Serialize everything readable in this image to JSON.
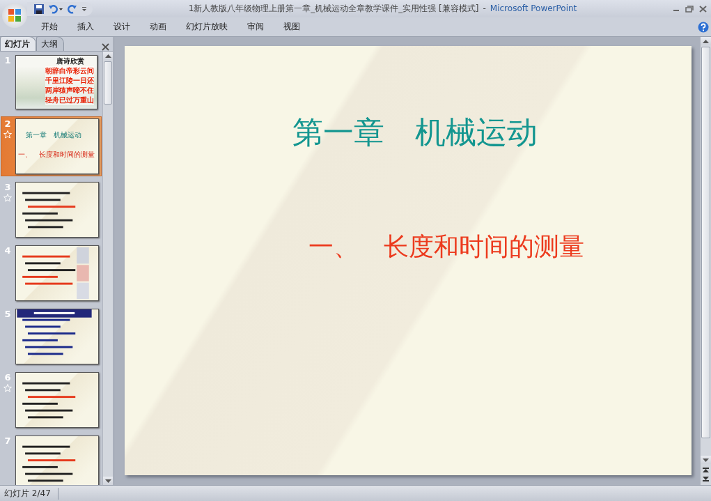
{
  "window": {
    "document_title": "1新人教版八年级物理上册第一章_机械运动全章教学课件_实用性强 [兼容模式]",
    "separator": "-",
    "app_name": "Microsoft PowerPoint"
  },
  "ribbon_tabs": [
    "开始",
    "插入",
    "设计",
    "动画",
    "幻灯片放映",
    "审阅",
    "视图"
  ],
  "pane_tabs": [
    {
      "label": "幻灯片",
      "selected": true
    },
    {
      "label": "大纲",
      "selected": false
    }
  ],
  "thumbnails": [
    {
      "number": "1",
      "kind": "poem",
      "selected": false,
      "animated": false,
      "title": "唐诗欣赏",
      "lines": [
        "朝辞白帝彩云间",
        "千里江陵一日还",
        "两岸猿声啼不住",
        "轻舟已过万重山"
      ]
    },
    {
      "number": "2",
      "kind": "title",
      "selected": true,
      "animated": true,
      "title": "第一章　机械运动",
      "subtitle": "一、　长度和时间的测量"
    },
    {
      "number": "3",
      "kind": "text",
      "selected": false,
      "animated": true
    },
    {
      "number": "4",
      "kind": "figures",
      "selected": false,
      "animated": false
    },
    {
      "number": "5",
      "kind": "banner",
      "selected": false,
      "animated": false
    },
    {
      "number": "6",
      "kind": "text",
      "selected": false,
      "animated": true
    },
    {
      "number": "7",
      "kind": "text",
      "selected": false,
      "animated": false
    }
  ],
  "slide": {
    "title": "第一章　机械运动",
    "subtitle": "一、　长度和时间的测量"
  },
  "status_bar": {
    "slide_counter": "幻灯片 2/47"
  }
}
